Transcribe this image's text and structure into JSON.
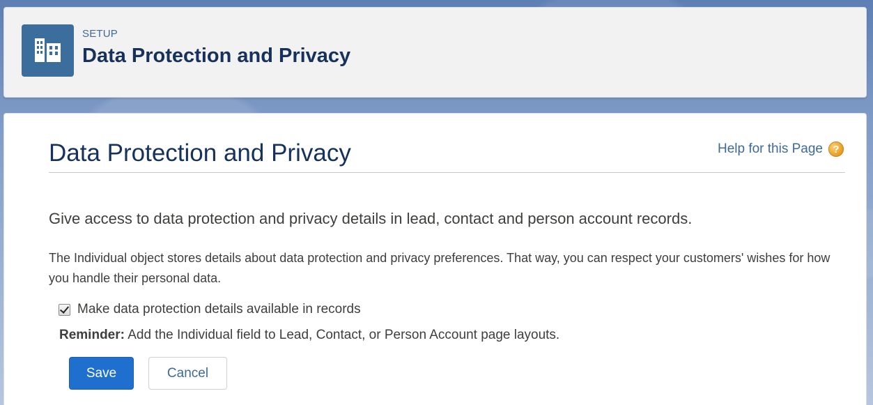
{
  "header": {
    "eyebrow": "SETUP",
    "title": "Data Protection and Privacy",
    "icon": "building-icon"
  },
  "page": {
    "title": "Data Protection and Privacy",
    "help_label": "Help for this Page",
    "help_icon": "question-icon",
    "lead": "Give access to data protection and privacy details in lead, contact and person account records.",
    "description": "The Individual object stores details about data protection and privacy preferences. That way, you can respect your customers' wishes for how you handle their personal data.",
    "checkbox": {
      "label": "Make data protection details available in records",
      "checked": true
    },
    "reminder": {
      "prefix": "Reminder:",
      "text": " Add the Individual field to Lead, Contact, or Person Account page layouts."
    },
    "buttons": {
      "save": "Save",
      "cancel": "Cancel"
    }
  },
  "colors": {
    "header_icon_bg": "#3c6e9d",
    "primary_button": "#1f6fcf",
    "link": "#3e6a99"
  }
}
